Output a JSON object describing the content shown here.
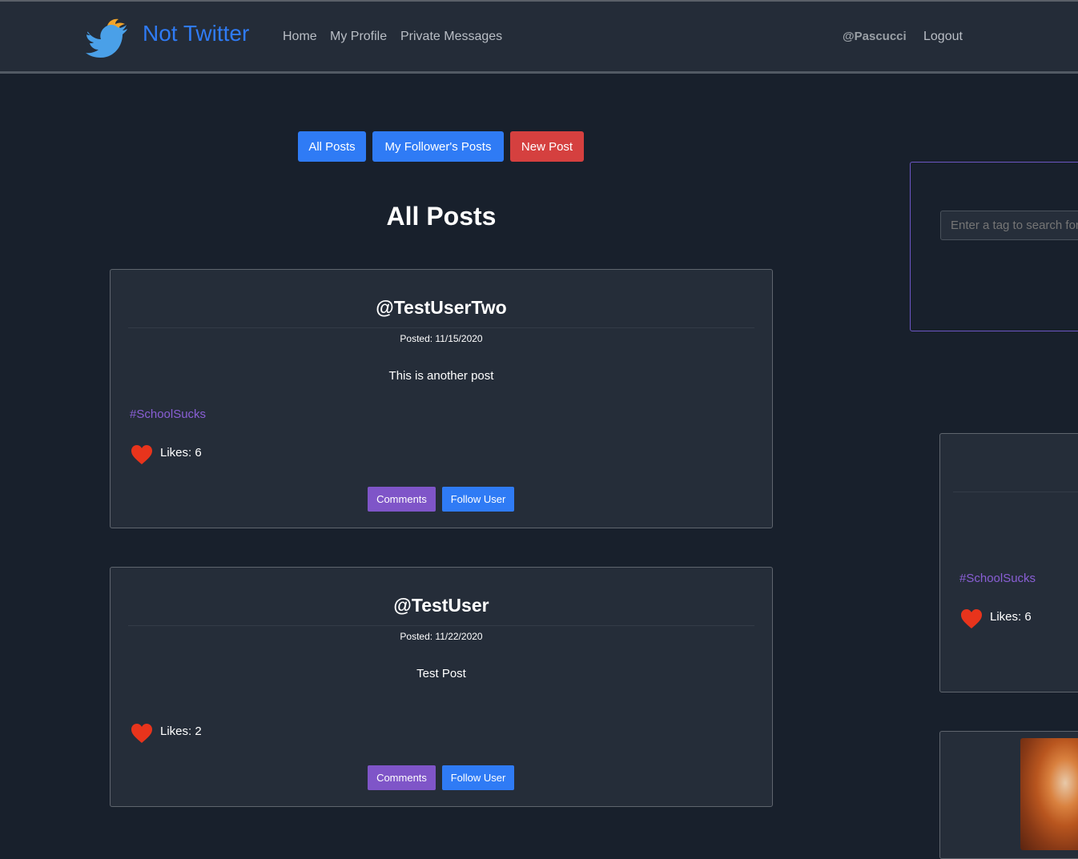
{
  "navbar": {
    "brand": "Not Twitter",
    "links": [
      "Home",
      "My Profile",
      "Private Messages"
    ],
    "user": "@Pascucci",
    "logout": "Logout"
  },
  "filters": {
    "all_posts": "All Posts",
    "followers_posts": "My Follower's Posts",
    "new_post": "New Post"
  },
  "page_title": "All Posts",
  "search": {
    "placeholder": "Enter a tag to search for"
  },
  "posts": [
    {
      "user": "@TestUserTwo",
      "date": "Posted: 11/15/2020",
      "body": "This is another post",
      "tag": "#SchoolSucks",
      "likes": "Likes: 6",
      "comments_label": "Comments",
      "follow_label": "Follow User"
    },
    {
      "user": "@TestUser",
      "date": "Posted: 11/22/2020",
      "body": "Test Post",
      "likes": "Likes: 2",
      "comments_label": "Comments",
      "follow_label": "Follow User"
    }
  ],
  "sidebar_post": {
    "tag": "#SchoolSucks",
    "likes": "Likes: 6"
  },
  "colors": {
    "primary": "#2f7bf5",
    "danger": "#d5403f",
    "purple": "#7f55c8",
    "heart": "#e8341c",
    "background": "#18202c",
    "card": "#252d39"
  },
  "icons": [
    "twitter-bird-icon",
    "heart-icon"
  ]
}
